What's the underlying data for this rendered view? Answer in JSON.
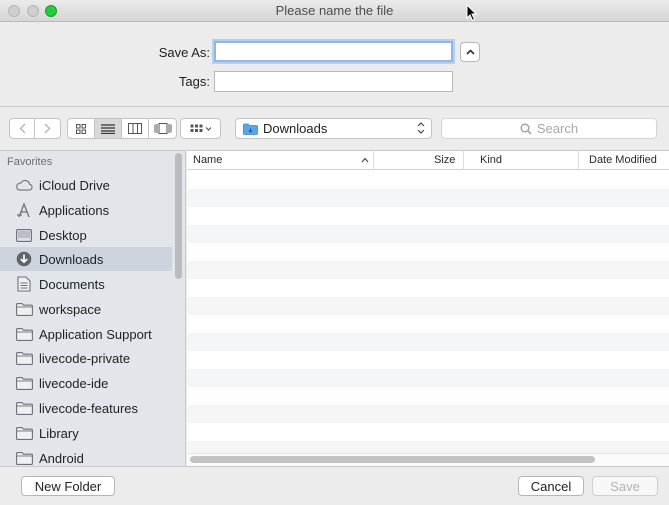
{
  "window": {
    "title": "Please name the file"
  },
  "form": {
    "save_as_label": "Save As:",
    "save_as_value": "",
    "tags_label": "Tags:",
    "tags_value": ""
  },
  "toolbar": {
    "location": "Downloads",
    "search_placeholder": "Search",
    "view_mode_selected": "list"
  },
  "sidebar": {
    "heading": "Favorites",
    "items": [
      {
        "label": "iCloud Drive",
        "icon": "cloud-icon"
      },
      {
        "label": "Applications",
        "icon": "applications-icon"
      },
      {
        "label": "Desktop",
        "icon": "desktop-icon"
      },
      {
        "label": "Downloads",
        "icon": "downloads-icon",
        "selected": true
      },
      {
        "label": "Documents",
        "icon": "documents-icon"
      },
      {
        "label": "workspace",
        "icon": "folder-icon"
      },
      {
        "label": "Application Support",
        "icon": "folder-icon"
      },
      {
        "label": "livecode-private",
        "icon": "folder-icon"
      },
      {
        "label": "livecode-ide",
        "icon": "folder-icon"
      },
      {
        "label": "livecode-features",
        "icon": "folder-icon"
      },
      {
        "label": "Library",
        "icon": "folder-icon"
      },
      {
        "label": "Android",
        "icon": "folder-icon"
      }
    ]
  },
  "columns": {
    "name": "Name",
    "size": "Size",
    "kind": "Kind",
    "date_modified": "Date Modified"
  },
  "buttons": {
    "new_folder": "New Folder",
    "cancel": "Cancel",
    "save": "Save"
  },
  "colors": {
    "focus_ring": "#8fb5ea",
    "selection": "#cdd4dd",
    "zoom_button": "#28c840"
  }
}
